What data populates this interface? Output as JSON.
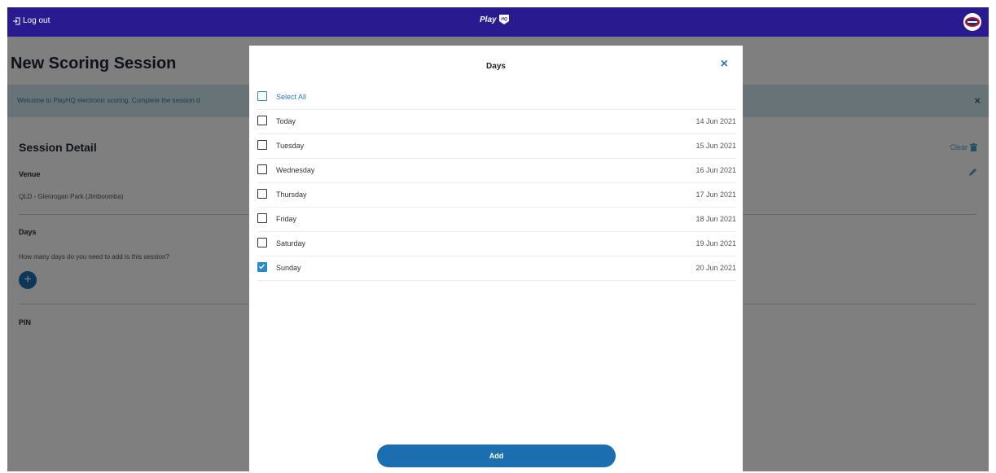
{
  "topbar": {
    "logout_label": "Log out",
    "brand_label": "Play",
    "brand_badge": "HQ"
  },
  "page": {
    "title": "New Scoring Session",
    "banner_text": "Welcome to PlayHQ electronic scoring. Complete the session d",
    "banner_close": "×",
    "section_title": "Session Detail",
    "clear_label": "Clear",
    "venue_label": "Venue",
    "venue_value": "QLD - Glenrogan Park (Jimboomba)",
    "days_label": "Days",
    "days_prompt": "How many days do you need to add to this session?",
    "add_circle": "+",
    "pin_label": "PIN"
  },
  "modal": {
    "title": "Days",
    "close": "×",
    "select_all_label": "Select All",
    "rows": [
      {
        "label": "Today",
        "date": "14 Jun 2021",
        "checked": false
      },
      {
        "label": "Tuesday",
        "date": "15 Jun 2021",
        "checked": false
      },
      {
        "label": "Wednesday",
        "date": "16 Jun 2021",
        "checked": false
      },
      {
        "label": "Thursday",
        "date": "17 Jun 2021",
        "checked": false
      },
      {
        "label": "Friday",
        "date": "18 Jun 2021",
        "checked": false
      },
      {
        "label": "Saturday",
        "date": "19 Jun 2021",
        "checked": false
      },
      {
        "label": "Sunday",
        "date": "20 Jun 2021",
        "checked": true
      }
    ],
    "add_button": "Add"
  },
  "colors": {
    "topbar": "#2a1a8f",
    "accent": "#2a8ac8",
    "button": "#1b6fb0"
  }
}
